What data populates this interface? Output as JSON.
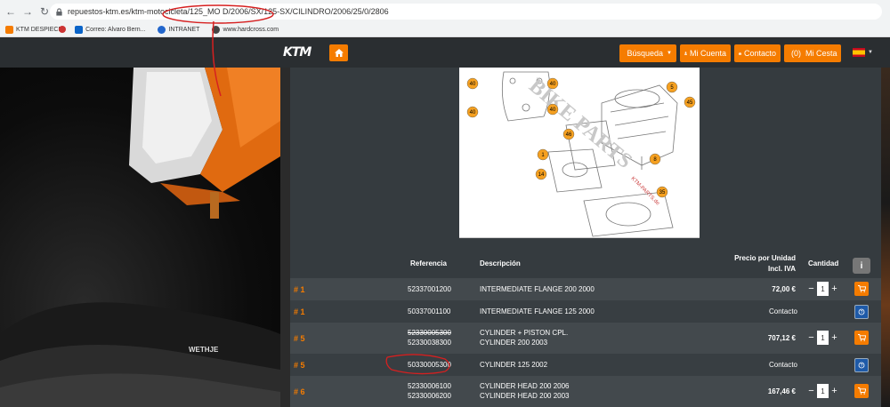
{
  "browser": {
    "url": "repuestos-ktm.es/ktm-motocicleta/125_MO D/2006/SX/125-SX/CILINDRO/2006/25/0/2806",
    "bookmarks": [
      "KTM DESPIECE",
      "Correo: Alvaro Bern...",
      "INTRANET",
      "www.hardcross.com"
    ]
  },
  "header": {
    "logo": "KTM",
    "search_label": "Búsqueda",
    "account_label": "Mi Cuenta",
    "contact_label": "Contacto",
    "cart_label": "(0)  Mi Cesta"
  },
  "diagram": {
    "watermark": "BIKE PARTS",
    "watermark_small": "KTM-PARTS.de",
    "callouts": [
      "40",
      "40",
      "40",
      "40",
      "5",
      "45",
      "46",
      "1",
      "8",
      "14",
      "35"
    ]
  },
  "table": {
    "headers": {
      "ref": "Referencia",
      "desc": "Descripción",
      "price_l1": "Precio por Unidad",
      "price_l2": "Incl. IVA",
      "qty": "Cantidad"
    },
    "rows": [
      {
        "pos": "# 1",
        "ref1": "52337001200",
        "desc1": "INTERMEDIATE FLANGE 200 2000",
        "price": "72,00 €",
        "qty": "1"
      },
      {
        "pos": "# 1",
        "ref1": "50337001100",
        "desc1": "INTERMEDIATE FLANGE 125 2000",
        "contact": "Contacto"
      },
      {
        "pos": "# 5",
        "ref1": "52330005300",
        "ref2": "52330038300",
        "desc1": "CYLINDER + PISTON CPL.",
        "desc2": "CYLINDER 200 2003",
        "price": "707,12 €",
        "qty": "1"
      },
      {
        "pos": "# 5",
        "ref1": "50330005300",
        "desc1": "CYLINDER 125 2002",
        "contact": "Contacto"
      },
      {
        "pos": "# 6",
        "ref1": "52330006100",
        "ref2": "52330006200",
        "desc1": "CYLINDER HEAD 200 2006",
        "desc2": "CYLINDER HEAD 200 2003",
        "price": "167,46 €",
        "qty": "1"
      }
    ]
  },
  "photo": {
    "brand_text": "WETHJE"
  },
  "colors": {
    "accent": "#f57c00",
    "header_bg": "#2a2e31",
    "panel_bg": "#353b3f",
    "annotation": "#d62020"
  }
}
